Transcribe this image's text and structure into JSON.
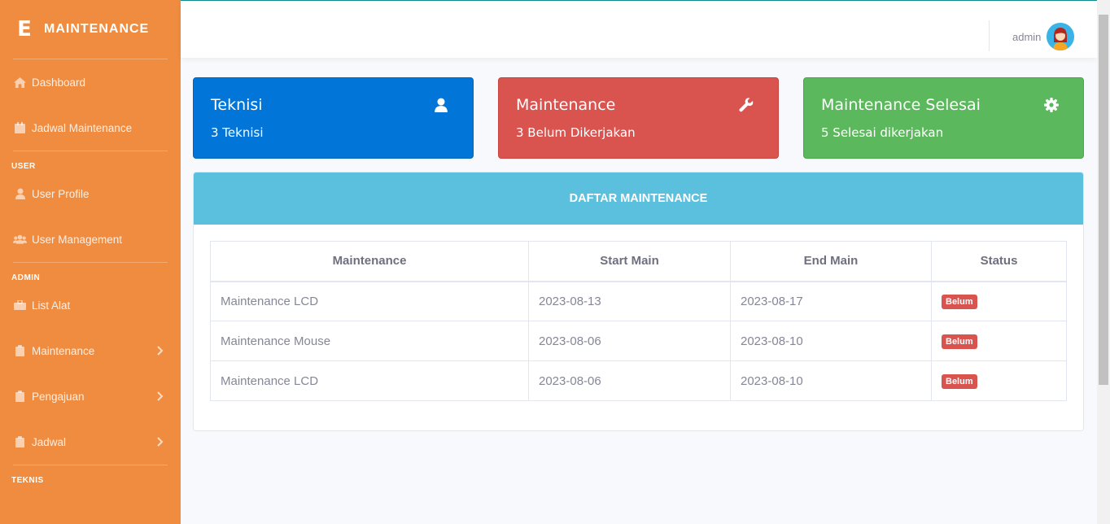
{
  "brand": {
    "title": "MAINTENANCE",
    "logo_letter": "E"
  },
  "sidebar": {
    "main_items": [
      {
        "label": "Dashboard",
        "icon": "home-icon"
      },
      {
        "label": "Jadwal Maintenance",
        "icon": "calendar-icon"
      }
    ],
    "section_user": "USER",
    "user_items": [
      {
        "label": "User Profile",
        "icon": "user-icon"
      },
      {
        "label": "User Management",
        "icon": "users-icon"
      }
    ],
    "section_admin": "ADMIN",
    "admin_items": [
      {
        "label": "List Alat",
        "icon": "toolbox-icon"
      },
      {
        "label": "Maintenance",
        "icon": "clipboard-icon"
      },
      {
        "label": "Pengajuan",
        "icon": "clipboard-icon"
      },
      {
        "label": "Jadwal",
        "icon": "clipboard-icon"
      }
    ],
    "section_teknis": "TEKNIS"
  },
  "topbar": {
    "username": "admin"
  },
  "cards": [
    {
      "title": "Teknisi",
      "subtitle": "3 Teknisi",
      "icon": "user-icon",
      "color": "#0275d8"
    },
    {
      "title": "Maintenance",
      "subtitle": "3 Belum Dikerjakan",
      "icon": "wrench-icon",
      "color": "#d9534f"
    },
    {
      "title": "Maintenance Selesai",
      "subtitle": "5 Selesai dikerjakan",
      "icon": "gear-icon",
      "color": "#5cb85c"
    }
  ],
  "panel": {
    "title": "DAFTAR MAINTENANCE",
    "columns": [
      "Maintenance",
      "Start Main",
      "End Main",
      "Status"
    ],
    "rows": [
      {
        "name": "Maintenance LCD",
        "start": "2023-08-13",
        "end": "2023-08-17",
        "status": "Belum"
      },
      {
        "name": "Maintenance Mouse",
        "start": "2023-08-06",
        "end": "2023-08-10",
        "status": "Belum"
      },
      {
        "name": "Maintenance LCD",
        "start": "2023-08-06",
        "end": "2023-08-10",
        "status": "Belum"
      }
    ]
  },
  "colors": {
    "sidebar": "#f08c3f",
    "panel_header": "#5bc0de",
    "badge": "#d9534f"
  }
}
